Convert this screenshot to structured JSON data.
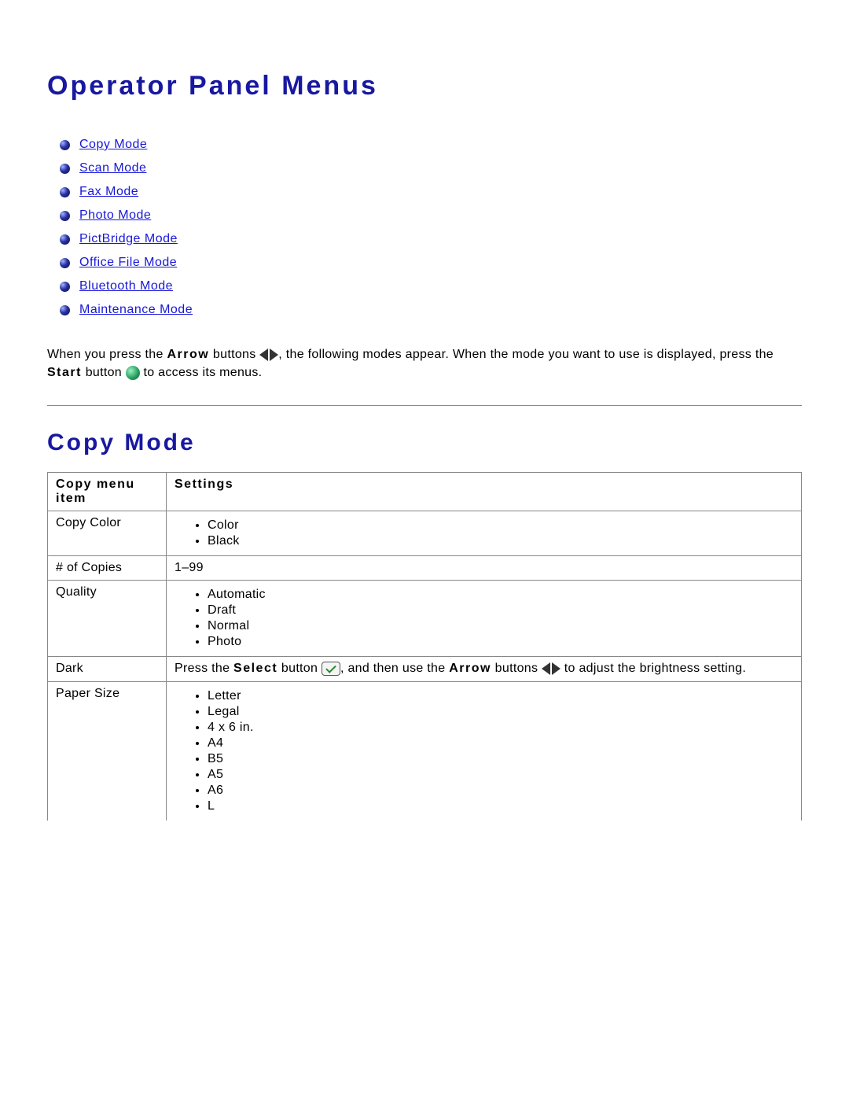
{
  "page_title": "Operator Panel Menus",
  "nav": [
    "Copy Mode",
    "Scan Mode",
    "Fax Mode",
    "Photo Mode",
    "PictBridge Mode",
    "Office File Mode",
    "Bluetooth Mode",
    "Maintenance Mode"
  ],
  "intro": {
    "part1": "When you press the ",
    "arrow_label": "Arrow",
    "part2": " buttons ",
    "part3": ", the following modes appear. When the mode you want to use is displayed, press the ",
    "start_label": "Start",
    "part4": " button ",
    "part5": " to access its menus."
  },
  "section_title": "Copy Mode",
  "table": {
    "header_col1": "Copy menu item",
    "header_col2": "Settings",
    "rows": [
      {
        "item": "Copy Color",
        "type": "list",
        "values": [
          "Color",
          "Black"
        ]
      },
      {
        "item": "# of Copies",
        "type": "text",
        "value": "1–99"
      },
      {
        "item": "Quality",
        "type": "list",
        "values": [
          "Automatic",
          "Draft",
          "Normal",
          "Photo"
        ]
      },
      {
        "item": "Dark",
        "type": "dark",
        "pre": "Press the ",
        "select_label": "Select",
        "mid1": " button ",
        "mid2": ", and then use the ",
        "arrow_label": "Arrow",
        "mid3": " buttons ",
        "post": " to adjust the brightness setting."
      },
      {
        "item": "Paper Size",
        "type": "list",
        "values": [
          "Letter",
          "Legal",
          "4 x 6 in.",
          "A4",
          "B5",
          "A5",
          "A6",
          "L"
        ]
      }
    ]
  }
}
